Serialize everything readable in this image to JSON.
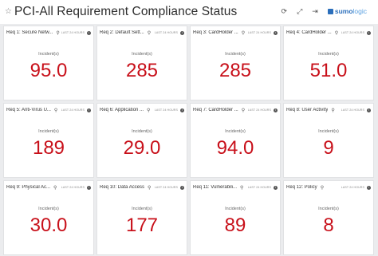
{
  "dashboard": {
    "title": "PCI-All Requirement Compliance Status",
    "brand_main": "sumo",
    "brand_accent": "logic",
    "icons": [
      "star-icon",
      "refresh-icon",
      "expand-icon",
      "share-icon"
    ]
  },
  "colors": {
    "value": "#c8101a",
    "brand": "#2a6ebb",
    "canvas": "#ebecee"
  },
  "panel_label": "Incident(s)",
  "range_label": "LAST 24 HOURS",
  "panels": [
    {
      "title": "Req 1: Secure Netw...",
      "value": "95.0"
    },
    {
      "title": "Req 2: Default Sett...",
      "value": "285"
    },
    {
      "title": "Req 3: CardHolder ...",
      "value": "285"
    },
    {
      "title": "Req 4: CardHolder ...",
      "value": "51.0"
    },
    {
      "title": "Req 5: Anti-Virus U...",
      "value": "189"
    },
    {
      "title": "Req 6: Application ...",
      "value": "29.0"
    },
    {
      "title": "Req 7: CardHolder ...",
      "value": "94.0"
    },
    {
      "title": "Req 8: User Activity",
      "value": "9"
    },
    {
      "title": "Req 9: Physical Ac...",
      "value": "30.0"
    },
    {
      "title": "Req 10: Data Access",
      "value": "177"
    },
    {
      "title": "Req 11: Vulnerabili...",
      "value": "89"
    },
    {
      "title": "Req 12: Policy",
      "value": "8"
    }
  ]
}
